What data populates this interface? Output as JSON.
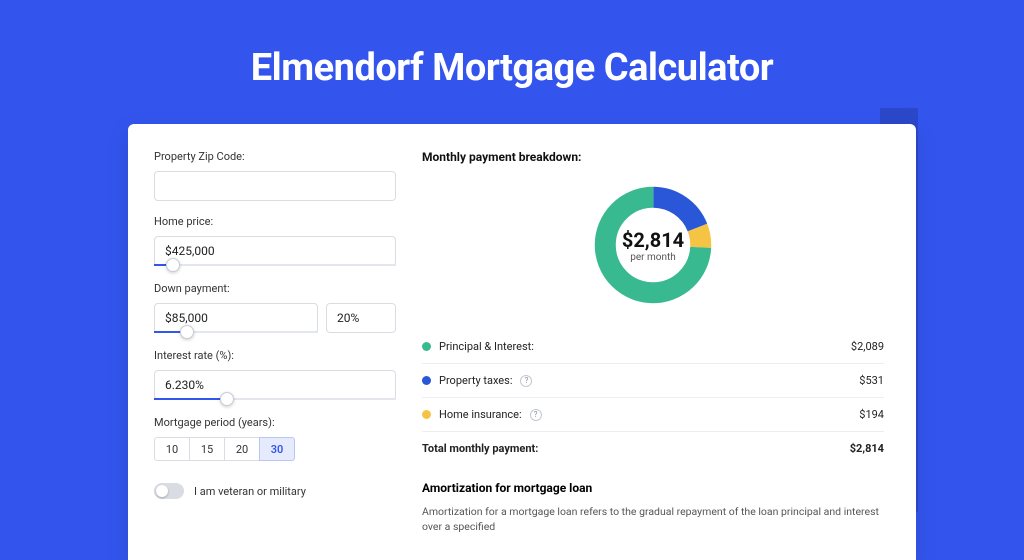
{
  "colors": {
    "accent": "#3355ee",
    "green": "#39b98f",
    "blue": "#2a57d8",
    "yellow": "#f6c445"
  },
  "hero": {
    "title": "Elmendorf Mortgage Calculator"
  },
  "form": {
    "zip": {
      "label": "Property Zip Code:",
      "value": ""
    },
    "price": {
      "label": "Home price:",
      "value": "$425,000",
      "slider_pct": 8
    },
    "down": {
      "label": "Down payment:",
      "amount": "$85,000",
      "pct": "20%",
      "slider_pct": 20
    },
    "rate": {
      "label": "Interest rate (%):",
      "value": "6.230%",
      "slider_pct": 30
    },
    "period": {
      "label": "Mortgage period (years):",
      "options": [
        "10",
        "15",
        "20",
        "30"
      ],
      "selected": "30"
    },
    "veteran_label": "I am veteran or military",
    "veteran_on": false
  },
  "breakdown": {
    "title": "Monthly payment breakdown:",
    "center_value": "$2,814",
    "center_label": "per month",
    "items": [
      {
        "label": "Principal & Interest:",
        "value": "$2,089",
        "pct": 74.2,
        "color": "#39b98f",
        "info": false
      },
      {
        "label": "Property taxes:",
        "value": "$531",
        "pct": 18.9,
        "color": "#2a57d8",
        "info": true
      },
      {
        "label": "Home insurance:",
        "value": "$194",
        "pct": 6.9,
        "color": "#f6c445",
        "info": true
      }
    ],
    "total_label": "Total monthly payment:",
    "total_value": "$2,814"
  },
  "amortization": {
    "title": "Amortization for mortgage loan",
    "body": "Amortization for a mortgage loan refers to the gradual repayment of the loan principal and interest over a specified"
  },
  "chart_data": {
    "type": "pie",
    "title": "Monthly payment breakdown",
    "series": [
      {
        "name": "Principal & Interest",
        "value": 2089,
        "pct": 74.2,
        "color": "#39b98f"
      },
      {
        "name": "Property taxes",
        "value": 531,
        "pct": 18.9,
        "color": "#2a57d8"
      },
      {
        "name": "Home insurance",
        "value": 194,
        "pct": 6.9,
        "color": "#f6c445"
      }
    ],
    "total": 2814,
    "center_label": "per month"
  }
}
